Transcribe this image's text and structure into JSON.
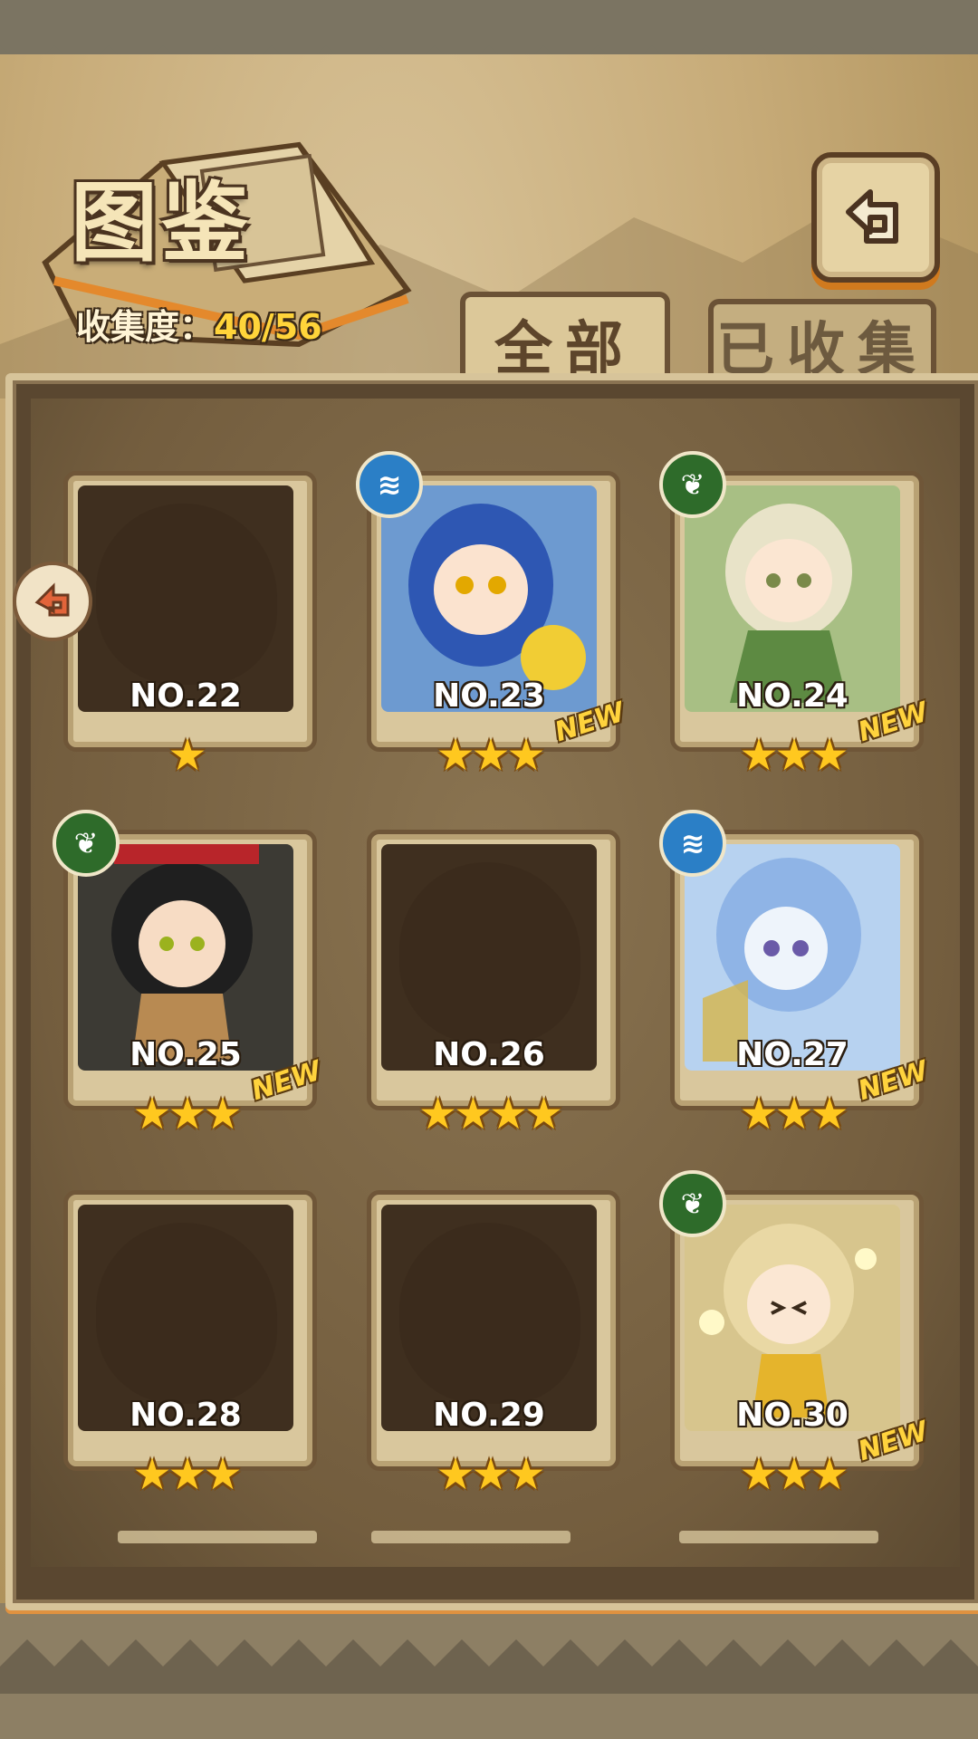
{
  "header": {
    "title": "图鉴",
    "collection_label": "收集度：",
    "collection_count": "40/56",
    "back_icon": "back-arrow-icon"
  },
  "tabs": [
    {
      "label": "全部",
      "selected": true
    },
    {
      "label": "已收集",
      "selected": false
    }
  ],
  "cards": [
    {
      "no": "NO.22",
      "stars": "★",
      "new": "",
      "element": "",
      "revealed": false
    },
    {
      "no": "NO.23",
      "stars": "★★★",
      "new": "NEW",
      "element": "water",
      "revealed": true
    },
    {
      "no": "NO.24",
      "stars": "★★★",
      "new": "NEW",
      "element": "leaf",
      "revealed": true
    },
    {
      "no": "NO.25",
      "stars": "★★★",
      "new": "NEW",
      "element": "leaf",
      "revealed": true
    },
    {
      "no": "NO.26",
      "stars": "★★★★",
      "new": "",
      "element": "",
      "revealed": false
    },
    {
      "no": "NO.27",
      "stars": "★★★",
      "new": "NEW",
      "element": "water",
      "revealed": true
    },
    {
      "no": "NO.28",
      "stars": "★★★",
      "new": "",
      "element": "",
      "revealed": false
    },
    {
      "no": "NO.29",
      "stars": "★★★",
      "new": "",
      "element": "",
      "revealed": false
    },
    {
      "no": "NO.30",
      "stars": "★★★",
      "new": "NEW",
      "element": "leaf",
      "revealed": true
    }
  ],
  "colors": {
    "star": "#ffc81f",
    "new_badge": "#ffd33d",
    "water": "#2b7fc6",
    "leaf": "#2e6b2a"
  },
  "icons": {
    "water": "water-element-icon",
    "leaf": "leaf-element-icon",
    "side_arrow": "prev-page-arrow-icon"
  }
}
